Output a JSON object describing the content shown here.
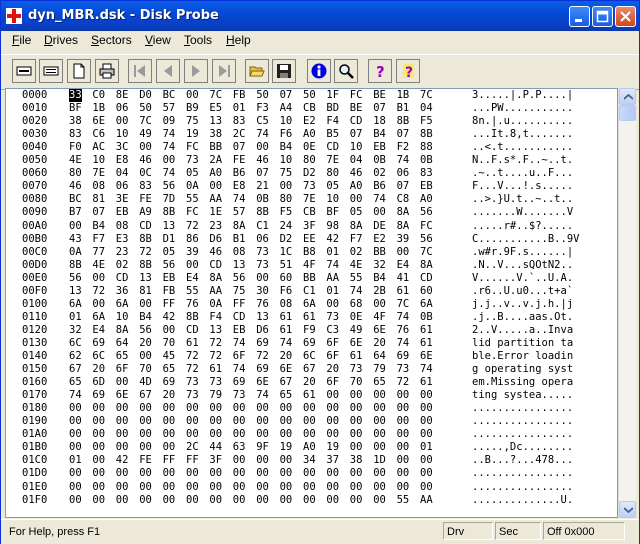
{
  "window": {
    "title": "dyn_MBR.dsk - Disk Probe"
  },
  "menu": [
    {
      "ul": "F",
      "rest": "ile"
    },
    {
      "ul": "D",
      "rest": "rives"
    },
    {
      "ul": "S",
      "rest": "ectors"
    },
    {
      "ul": "V",
      "rest": "iew"
    },
    {
      "ul": "T",
      "rest": "ools"
    },
    {
      "ul": "H",
      "rest": "elp"
    }
  ],
  "toolbar": [
    "read-sector-icon",
    "read-partition-icon",
    "new-document-icon",
    "print-icon",
    "first-sector-icon",
    "previous-sector-icon",
    "next-sector-icon",
    "last-sector-icon",
    "open-folder-icon",
    "save-icon",
    "info-icon",
    "find-icon",
    "help-icon",
    "context-help-icon"
  ],
  "hex": [
    {
      "addr": "0000",
      "bytes": [
        "33",
        "C0",
        "8E",
        "D0",
        "BC",
        "00",
        "7C",
        "FB",
        "50",
        "07",
        "50",
        "1F",
        "FC",
        "BE",
        "1B",
        "7C"
      ],
      "ascii": "3.....|.P.P....|"
    },
    {
      "addr": "0010",
      "bytes": [
        "BF",
        "1B",
        "06",
        "50",
        "57",
        "B9",
        "E5",
        "01",
        "F3",
        "A4",
        "CB",
        "BD",
        "BE",
        "07",
        "B1",
        "04"
      ],
      "ascii": "...PW..........."
    },
    {
      "addr": "0020",
      "bytes": [
        "38",
        "6E",
        "00",
        "7C",
        "09",
        "75",
        "13",
        "83",
        "C5",
        "10",
        "E2",
        "F4",
        "CD",
        "18",
        "8B",
        "F5"
      ],
      "ascii": "8n.|.u.........."
    },
    {
      "addr": "0030",
      "bytes": [
        "83",
        "C6",
        "10",
        "49",
        "74",
        "19",
        "38",
        "2C",
        "74",
        "F6",
        "A0",
        "B5",
        "07",
        "B4",
        "07",
        "8B"
      ],
      "ascii": "...It.8,t......."
    },
    {
      "addr": "0040",
      "bytes": [
        "F0",
        "AC",
        "3C",
        "00",
        "74",
        "FC",
        "BB",
        "07",
        "00",
        "B4",
        "0E",
        "CD",
        "10",
        "EB",
        "F2",
        "88"
      ],
      "ascii": "..<.t..........."
    },
    {
      "addr": "0050",
      "bytes": [
        "4E",
        "10",
        "E8",
        "46",
        "00",
        "73",
        "2A",
        "FE",
        "46",
        "10",
        "80",
        "7E",
        "04",
        "0B",
        "74",
        "0B"
      ],
      "ascii": "N..F.s*.F..~..t."
    },
    {
      "addr": "0060",
      "bytes": [
        "80",
        "7E",
        "04",
        "0C",
        "74",
        "05",
        "A0",
        "B6",
        "07",
        "75",
        "D2",
        "80",
        "46",
        "02",
        "06",
        "83"
      ],
      "ascii": ".~..t....u..F..."
    },
    {
      "addr": "0070",
      "bytes": [
        "46",
        "08",
        "06",
        "83",
        "56",
        "0A",
        "00",
        "E8",
        "21",
        "00",
        "73",
        "05",
        "A0",
        "B6",
        "07",
        "EB"
      ],
      "ascii": "F...V...!.s....."
    },
    {
      "addr": "0080",
      "bytes": [
        "BC",
        "81",
        "3E",
        "FE",
        "7D",
        "55",
        "AA",
        "74",
        "0B",
        "80",
        "7E",
        "10",
        "00",
        "74",
        "C8",
        "A0"
      ],
      "ascii": "..>.}U.t..~..t.."
    },
    {
      "addr": "0090",
      "bytes": [
        "B7",
        "07",
        "EB",
        "A9",
        "8B",
        "FC",
        "1E",
        "57",
        "8B",
        "F5",
        "CB",
        "BF",
        "05",
        "00",
        "8A",
        "56"
      ],
      "ascii": ".......W.......V"
    },
    {
      "addr": "00A0",
      "bytes": [
        "00",
        "B4",
        "08",
        "CD",
        "13",
        "72",
        "23",
        "8A",
        "C1",
        "24",
        "3F",
        "98",
        "8A",
        "DE",
        "8A",
        "FC"
      ],
      "ascii": ".....r#..$?....."
    },
    {
      "addr": "00B0",
      "bytes": [
        "43",
        "F7",
        "E3",
        "8B",
        "D1",
        "86",
        "D6",
        "B1",
        "06",
        "D2",
        "EE",
        "42",
        "F7",
        "E2",
        "39",
        "56"
      ],
      "ascii": "C...........B..9V"
    },
    {
      "addr": "00C0",
      "bytes": [
        "0A",
        "77",
        "23",
        "72",
        "05",
        "39",
        "46",
        "08",
        "73",
        "1C",
        "B8",
        "01",
        "02",
        "BB",
        "00",
        "7C"
      ],
      "ascii": ".w#r.9F.s......|"
    },
    {
      "addr": "00D0",
      "bytes": [
        "8B",
        "4E",
        "02",
        "8B",
        "56",
        "00",
        "CD",
        "13",
        "73",
        "51",
        "4F",
        "74",
        "4E",
        "32",
        "E4",
        "8A"
      ],
      "ascii": ".N..V...sQOtN2.."
    },
    {
      "addr": "00E0",
      "bytes": [
        "56",
        "00",
        "CD",
        "13",
        "EB",
        "E4",
        "8A",
        "56",
        "00",
        "60",
        "BB",
        "AA",
        "55",
        "B4",
        "41",
        "CD"
      ],
      "ascii": "V......V.`..U.A."
    },
    {
      "addr": "00F0",
      "bytes": [
        "13",
        "72",
        "36",
        "81",
        "FB",
        "55",
        "AA",
        "75",
        "30",
        "F6",
        "C1",
        "01",
        "74",
        "2B",
        "61",
        "60"
      ],
      "ascii": ".r6..U.u0...t+a`"
    },
    {
      "addr": "0100",
      "bytes": [
        "6A",
        "00",
        "6A",
        "00",
        "FF",
        "76",
        "0A",
        "FF",
        "76",
        "08",
        "6A",
        "00",
        "68",
        "00",
        "7C",
        "6A"
      ],
      "ascii": "j.j..v..v.j.h.|j"
    },
    {
      "addr": "0110",
      "bytes": [
        "01",
        "6A",
        "10",
        "B4",
        "42",
        "8B",
        "F4",
        "CD",
        "13",
        "61",
        "61",
        "73",
        "0E",
        "4F",
        "74",
        "0B"
      ],
      "ascii": ".j..B....aas.Ot."
    },
    {
      "addr": "0120",
      "bytes": [
        "32",
        "E4",
        "8A",
        "56",
        "00",
        "CD",
        "13",
        "EB",
        "D6",
        "61",
        "F9",
        "C3",
        "49",
        "6E",
        "76",
        "61"
      ],
      "ascii": "2..V.....a..Inva"
    },
    {
      "addr": "0130",
      "bytes": [
        "6C",
        "69",
        "64",
        "20",
        "70",
        "61",
        "72",
        "74",
        "69",
        "74",
        "69",
        "6F",
        "6E",
        "20",
        "74",
        "61"
      ],
      "ascii": "lid partition ta"
    },
    {
      "addr": "0140",
      "bytes": [
        "62",
        "6C",
        "65",
        "00",
        "45",
        "72",
        "72",
        "6F",
        "72",
        "20",
        "6C",
        "6F",
        "61",
        "64",
        "69",
        "6E"
      ],
      "ascii": "ble.Error loadin"
    },
    {
      "addr": "0150",
      "bytes": [
        "67",
        "20",
        "6F",
        "70",
        "65",
        "72",
        "61",
        "74",
        "69",
        "6E",
        "67",
        "20",
        "73",
        "79",
        "73",
        "74"
      ],
      "ascii": "g operating syst"
    },
    {
      "addr": "0160",
      "bytes": [
        "65",
        "6D",
        "00",
        "4D",
        "69",
        "73",
        "73",
        "69",
        "6E",
        "67",
        "20",
        "6F",
        "70",
        "65",
        "72",
        "61"
      ],
      "ascii": "em.Missing opera"
    },
    {
      "addr": "0170",
      "bytes": [
        "74",
        "69",
        "6E",
        "67",
        "20",
        "73",
        "79",
        "73",
        "74",
        "65",
        "61",
        "00",
        "00",
        "00",
        "00",
        "00"
      ],
      "ascii": "ting systea....."
    },
    {
      "addr": "0180",
      "bytes": [
        "00",
        "00",
        "00",
        "00",
        "00",
        "00",
        "00",
        "00",
        "00",
        "00",
        "00",
        "00",
        "00",
        "00",
        "00",
        "00"
      ],
      "ascii": "................"
    },
    {
      "addr": "0190",
      "bytes": [
        "00",
        "00",
        "00",
        "00",
        "00",
        "00",
        "00",
        "00",
        "00",
        "00",
        "00",
        "00",
        "00",
        "00",
        "00",
        "00"
      ],
      "ascii": "................"
    },
    {
      "addr": "01A0",
      "bytes": [
        "00",
        "00",
        "00",
        "00",
        "00",
        "00",
        "00",
        "00",
        "00",
        "00",
        "00",
        "00",
        "00",
        "00",
        "00",
        "00"
      ],
      "ascii": "................"
    },
    {
      "addr": "01B0",
      "bytes": [
        "00",
        "00",
        "00",
        "00",
        "00",
        "2C",
        "44",
        "63",
        "9F",
        "19",
        "A0",
        "19",
        "00",
        "00",
        "00",
        "01"
      ],
      "ascii": ".....,Dc........"
    },
    {
      "addr": "01C0",
      "bytes": [
        "01",
        "00",
        "42",
        "FE",
        "FF",
        "FF",
        "3F",
        "00",
        "00",
        "00",
        "34",
        "37",
        "38",
        "1D",
        "00",
        "00"
      ],
      "ascii": "..B...?...478..."
    },
    {
      "addr": "01D0",
      "bytes": [
        "00",
        "00",
        "00",
        "00",
        "00",
        "00",
        "00",
        "00",
        "00",
        "00",
        "00",
        "00",
        "00",
        "00",
        "00",
        "00"
      ],
      "ascii": "................"
    },
    {
      "addr": "01E0",
      "bytes": [
        "00",
        "00",
        "00",
        "00",
        "00",
        "00",
        "00",
        "00",
        "00",
        "00",
        "00",
        "00",
        "00",
        "00",
        "00",
        "00"
      ],
      "ascii": "................"
    },
    {
      "addr": "01F0",
      "bytes": [
        "00",
        "00",
        "00",
        "00",
        "00",
        "00",
        "00",
        "00",
        "00",
        "00",
        "00",
        "00",
        "00",
        "00",
        "55",
        "AA"
      ],
      "ascii": "..............U."
    }
  ],
  "status": {
    "help": "For Help, press F1",
    "drive": "Drv",
    "sector": "Sec",
    "offset": "Off 0x000"
  }
}
